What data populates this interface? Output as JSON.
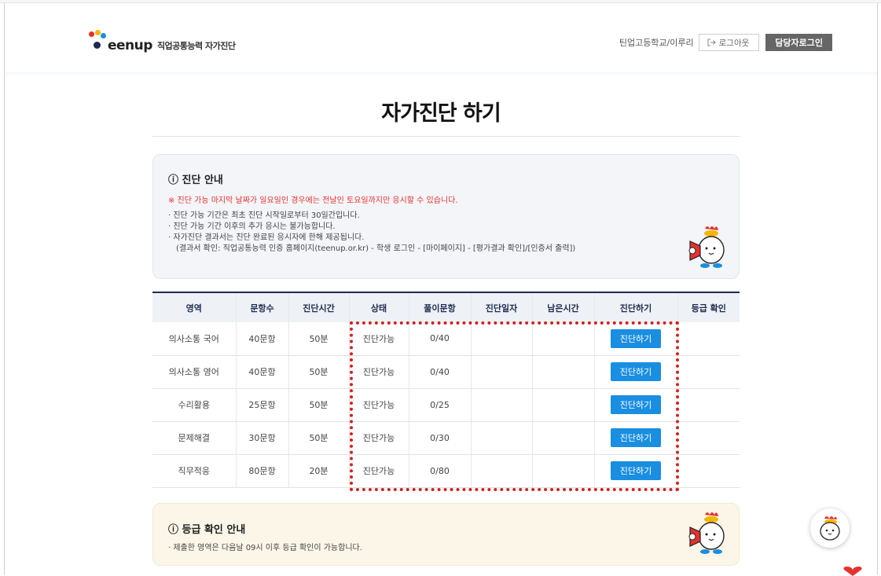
{
  "header": {
    "logo_word": "eenup",
    "logo_sub": "직업공통능력 자가진단",
    "user_name": "틴업고등학교/이루리",
    "logout_label": "로그아웃",
    "manager_login_label": "담당자로그인"
  },
  "page_title": "자가진단 하기",
  "notice": {
    "title": "ⓘ 진단 안내",
    "warning": "※ 진단 가능 마지막 날짜가 일요일인 경우에는 전날인 토요일까지만 응시할 수 있습니다.",
    "items": [
      "· 진단 가능 기간은 최초 진단 시작일로부터 30일간입니다.",
      "· 진단 가능 기간 이후의 추가 응시는 불가능합니다.",
      "· 자가진단 결과서는 진단 완료된 응시자에 한해 제공됩니다.",
      "(결과서 확인: 직업공통능력 인증 홈페이지(teenup.or.kr) - 학생 로그인 - [마이페이지] - [평가결과 확인]/[인증서 출력])"
    ]
  },
  "table": {
    "headers": [
      "영역",
      "문항수",
      "진단시간",
      "상태",
      "풀이문항",
      "진단일자",
      "남은시간",
      "진단하기",
      "등급 확인"
    ],
    "rows": [
      {
        "area": "의사소통 국어",
        "count": "40문항",
        "time": "50분",
        "status": "진단가능",
        "solved": "0/40",
        "date": "",
        "remaining": "",
        "action": "진단하기",
        "grade": ""
      },
      {
        "area": "의사소통 영어",
        "count": "40문항",
        "time": "50분",
        "status": "진단가능",
        "solved": "0/40",
        "date": "",
        "remaining": "",
        "action": "진단하기",
        "grade": ""
      },
      {
        "area": "수리활용",
        "count": "25문항",
        "time": "50분",
        "status": "진단가능",
        "solved": "0/25",
        "date": "",
        "remaining": "",
        "action": "진단하기",
        "grade": ""
      },
      {
        "area": "문제해결",
        "count": "30문항",
        "time": "50분",
        "status": "진단가능",
        "solved": "0/30",
        "date": "",
        "remaining": "",
        "action": "진단하기",
        "grade": ""
      },
      {
        "area": "직무적응",
        "count": "80문항",
        "time": "20분",
        "status": "진단가능",
        "solved": "0/80",
        "date": "",
        "remaining": "",
        "action": "진단하기",
        "grade": ""
      }
    ]
  },
  "grade_notice": {
    "title": "ⓘ 등급 확인 안내",
    "text": "· 제출한 영역은 다음날 09시 이후 등급 확인이 가능합니다."
  },
  "colors": {
    "accent_blue": "#1a8ee0",
    "navy": "#1d2b4f",
    "warning_red": "#e5322d",
    "highlight_red": "#d1231f",
    "logo_dots": [
      "#e6312f",
      "#f7b500",
      "#1a8ee0",
      "#1d2b4f"
    ]
  },
  "icons": {
    "logout": "logout-arrow-icon",
    "mascot": "chicken-megaphone-mascot",
    "float": "chatbot-mascot-icon"
  }
}
